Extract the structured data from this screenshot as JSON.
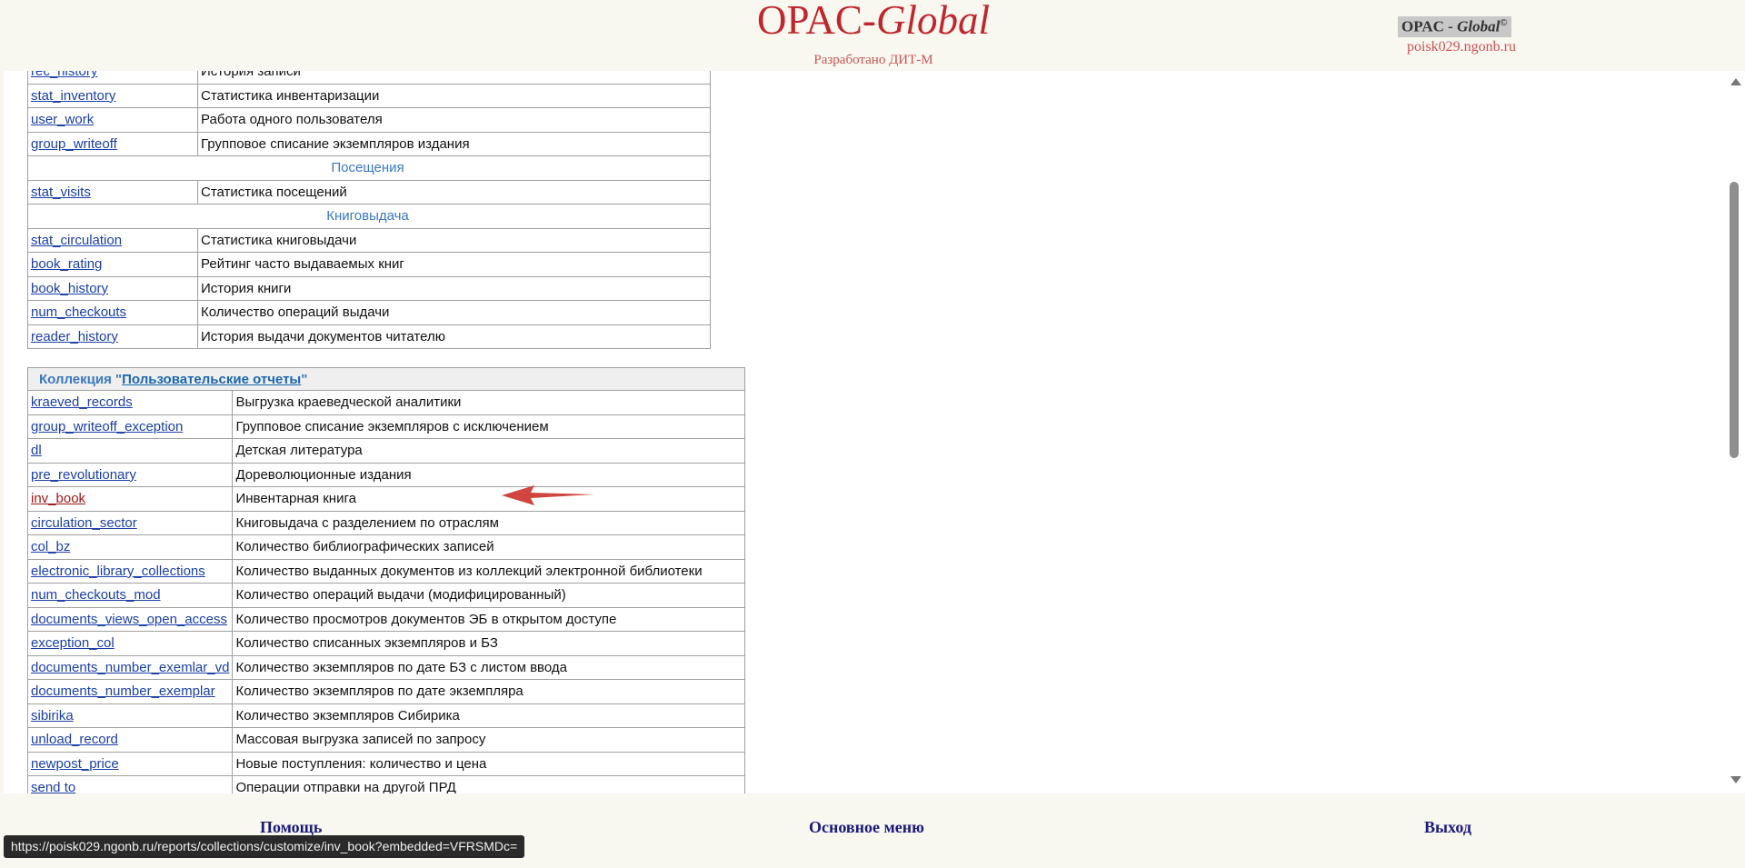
{
  "header": {
    "logo_main": "OPAC-",
    "logo_italic": "Global",
    "logo_subtitle": "Разработано ДИТ-М",
    "brand_text": "OPAC - ",
    "brand_italic": "Global",
    "brand_mark": "©",
    "host": "poisk029.ngonb.ru"
  },
  "table1": {
    "rows": [
      {
        "code": "rec_history",
        "desc": "История записи"
      },
      {
        "code": "stat_inventory",
        "desc": "Статистика инвентаризации"
      },
      {
        "code": "user_work",
        "desc": "Работа одного пользователя"
      },
      {
        "code": "group_writeoff",
        "desc": "Групповое списание экземпляров издания"
      }
    ],
    "section_visits": "Посещения",
    "visits_rows": [
      {
        "code": "stat_visits",
        "desc": "Статистика посещений"
      }
    ],
    "section_circulation": "Книговыдача",
    "circ_rows": [
      {
        "code": "stat_circulation",
        "desc": "Статистика книговыдачи"
      },
      {
        "code": "book_rating",
        "desc": "Рейтинг часто выдаваемых книг"
      },
      {
        "code": "book_history",
        "desc": "История книги"
      },
      {
        "code": "num_checkouts",
        "desc": "Количество операций выдачи"
      },
      {
        "code": "reader_history",
        "desc": "История выдачи документов читателю"
      }
    ]
  },
  "table2": {
    "collection_prefix": "Коллекция \"",
    "collection_name": "Пользовательские отчеты",
    "collection_suffix": "\"",
    "rows": [
      {
        "code": "kraeved_records",
        "desc": "Выгрузка краеведческой аналитики"
      },
      {
        "code": "group_writeoff_exception",
        "desc": "Групповое списание экземпляров с исключением"
      },
      {
        "code": "dl",
        "desc": "Детская литература"
      },
      {
        "code": "pre_revolutionary",
        "desc": "Дореволюционные издания"
      },
      {
        "code": "inv_book",
        "desc": "Инвентарная книга"
      },
      {
        "code": "circulation_sector",
        "desc": "Книговыдача с разделением по отраслям"
      },
      {
        "code": "col_bz",
        "desc": "Количество библиографических записей"
      },
      {
        "code": "electronic_library_collections",
        "desc": "Количество выданных документов из коллекций электронной библиотеки"
      },
      {
        "code": "num_checkouts_mod",
        "desc": "Количество операций выдачи (модифицированный)"
      },
      {
        "code": "documents_views_open_access",
        "desc": "Количество просмотров документов ЭБ в открытом доступе"
      },
      {
        "code": "exception_col",
        "desc": "Количество списанных экземпляров и БЗ"
      },
      {
        "code": "documents_number_exemlar_vd",
        "desc": "Количество экземпляров по дате БЗ с листом ввода"
      },
      {
        "code": "documents_number_exemplar",
        "desc": "Количество экземпляров по дате экземпляра"
      },
      {
        "code": "sibirika",
        "desc": "Количество экземпляров Сибирика"
      },
      {
        "code": "unload_record",
        "desc": "Массовая выгрузка записей по запросу"
      },
      {
        "code": "newpost_price",
        "desc": "Новые поступления: количество и цена"
      },
      {
        "code": "send to",
        "desc": "Операции отправки на другой ПРД"
      }
    ]
  },
  "footer": {
    "help": "Помощь",
    "main_menu": "Основное меню",
    "exit": "Выход"
  },
  "status_url": "https://poisk029.ngonb.ru/reports/collections/customize/inv_book?embedded=VFRSMDc=",
  "colors": {
    "link": "#1a3fa8",
    "visited_link": "#a01818",
    "logo": "#c0272d",
    "arrow": "#d0463f"
  }
}
